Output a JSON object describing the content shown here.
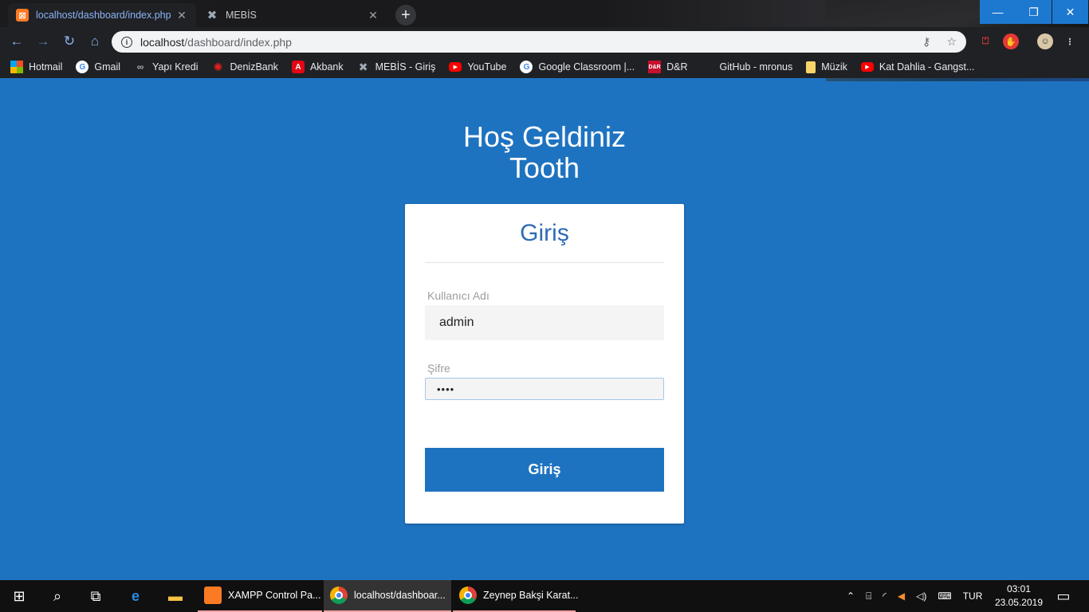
{
  "browser": {
    "tabs": [
      {
        "label": "localhost/dashboard/index.php",
        "favicon": "xampp-icon",
        "active": true
      },
      {
        "label": "MEBİS",
        "favicon": "mebis-icon",
        "active": false
      }
    ],
    "new_tab": "+",
    "address": {
      "host": "localhost",
      "path": "/dashboard/index.php"
    },
    "bookmarks": [
      {
        "label": "Hotmail",
        "icon": "microsoft-icon"
      },
      {
        "label": "Gmail",
        "icon": "google-icon"
      },
      {
        "label": "Yapı Kredi",
        "icon": "yapi-kredi-icon"
      },
      {
        "label": "DenizBank",
        "icon": "denizbank-icon"
      },
      {
        "label": "Akbank",
        "icon": "akbank-icon"
      },
      {
        "label": "MEBİS - Giriş",
        "icon": "mebis-icon"
      },
      {
        "label": "YouTube",
        "icon": "youtube-icon"
      },
      {
        "label": "Google Classroom |...",
        "icon": "google-icon"
      },
      {
        "label": "D&R",
        "icon": "dr-icon"
      },
      {
        "label": "GitHub - mronus",
        "icon": "github-icon"
      },
      {
        "label": "Müzik",
        "icon": "folder-icon"
      },
      {
        "label": "Kat Dahlia - Gangst...",
        "icon": "youtube-icon"
      }
    ]
  },
  "page": {
    "welcome_line1": "Hoş Geldiniz",
    "welcome_line2": "Tooth",
    "login": {
      "title": "Giriş",
      "username_label": "Kullanıcı Adı",
      "username_value": "admin",
      "password_label": "Şifre",
      "password_mask": "••••",
      "submit_label": "Giriş"
    }
  },
  "taskbar": {
    "apps": [
      {
        "label": "XAMPP Control Pa...",
        "icon": "xampp-icon"
      },
      {
        "label": "localhost/dashboar...",
        "icon": "chrome-icon"
      },
      {
        "label": "Zeynep Bakşi Karat...",
        "icon": "chrome-icon"
      }
    ],
    "language": "TUR",
    "time": "03:01",
    "date": "23.05.2019"
  },
  "colors": {
    "page_background": "#1e73c0",
    "card_title": "#2d6cb5",
    "button": "#1e73c0"
  }
}
